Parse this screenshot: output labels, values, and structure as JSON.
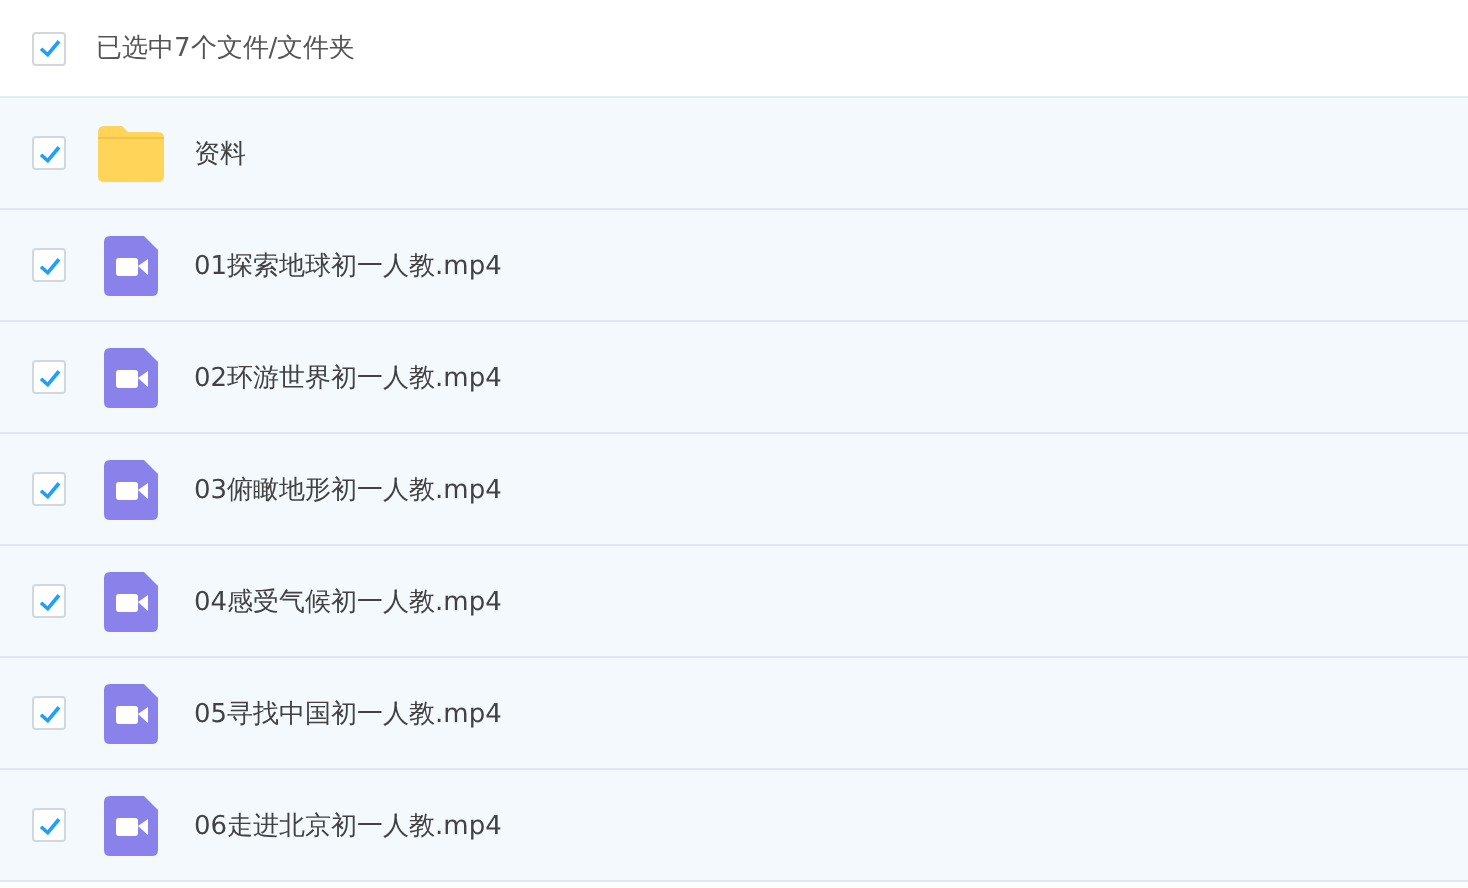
{
  "header": {
    "checked": true,
    "label": "已选中7个文件/文件夹"
  },
  "items": [
    {
      "kind": "folder",
      "name": "资料",
      "checked": true
    },
    {
      "kind": "video",
      "name": "01探索地球初一人教.mp4",
      "checked": true
    },
    {
      "kind": "video",
      "name": "02环游世界初一人教.mp4",
      "checked": true
    },
    {
      "kind": "video",
      "name": "03俯瞰地形初一人教.mp4",
      "checked": true
    },
    {
      "kind": "video",
      "name": "04感受气候初一人教.mp4",
      "checked": true
    },
    {
      "kind": "video",
      "name": "05寻找中国初一人教.mp4",
      "checked": true
    },
    {
      "kind": "video",
      "name": "06走进北京初一人教.mp4",
      "checked": true
    }
  ]
}
